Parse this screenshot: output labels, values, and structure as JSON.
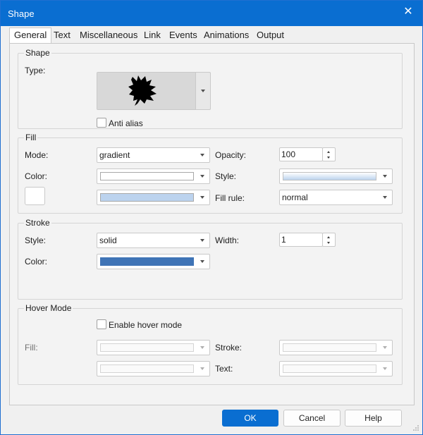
{
  "window": {
    "title": "Shape"
  },
  "tabs": [
    "General",
    "Text",
    "Miscellaneous",
    "Link",
    "Events",
    "Animations",
    "Output"
  ],
  "shape": {
    "group_title": "Shape",
    "type_label": "Type:",
    "type_icon": "starburst-callout-icon",
    "anti_alias_label": "Anti alias",
    "anti_alias_checked": false
  },
  "fill": {
    "group_title": "Fill",
    "mode_label": "Mode:",
    "mode_value": "gradient",
    "color_label": "Color:",
    "color1": "#ffffff",
    "color2": "#bcd3ee",
    "opacity_label": "Opacity:",
    "opacity_value": "100",
    "style_label": "Style:",
    "style_gradient_from": "#ffffff",
    "style_gradient_to": "#bcd3ee",
    "fill_rule_label": "Fill rule:",
    "fill_rule_value": "normal"
  },
  "stroke": {
    "group_title": "Stroke",
    "style_label": "Style:",
    "style_value": "solid",
    "color_label": "Color:",
    "color": "#3f74b6",
    "width_label": "Width:",
    "width_value": "1"
  },
  "hover": {
    "group_title": "Hover Mode",
    "enable_label": "Enable hover mode",
    "enable_checked": false,
    "fill_label": "Fill:",
    "stroke_label": "Stroke:",
    "text_label": "Text:"
  },
  "buttons": {
    "ok": "OK",
    "cancel": "Cancel",
    "help": "Help"
  },
  "colors": {
    "accent": "#0a6ed1",
    "close_icon": "close-icon"
  }
}
